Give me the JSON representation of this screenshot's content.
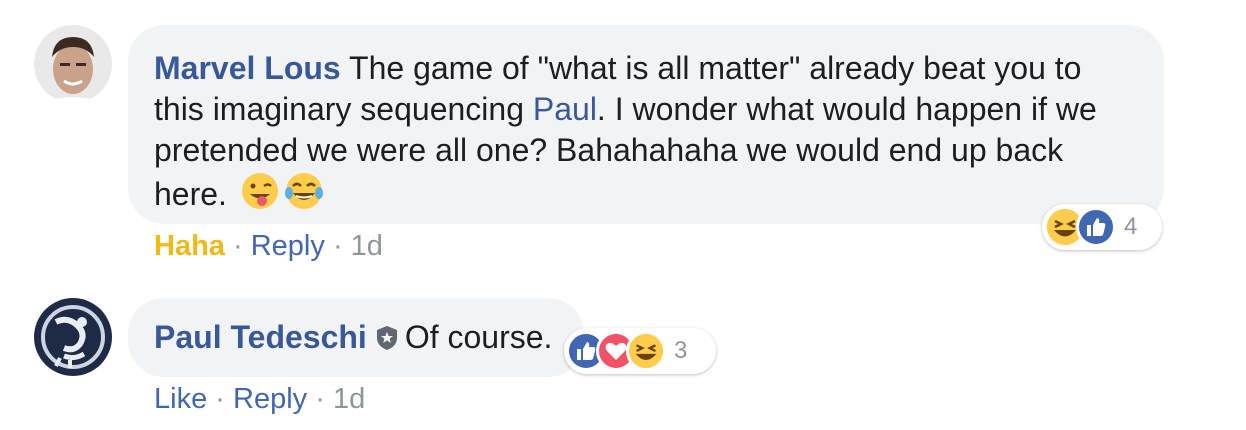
{
  "comment1": {
    "author": "Marvel Lous",
    "text_before": " The game of \"what is all matter\" already beat you to this imaginary sequencing ",
    "mention": "Paul",
    "text_after": ". I wonder what would happen if we pretended we were all one? Bahahahaha we would end up back here.",
    "action_reacted": "Haha",
    "action_reply": "Reply",
    "separator": "·",
    "time": "1d",
    "reaction_count": "4",
    "reaction_icons": [
      "haha-icon",
      "like-icon"
    ],
    "emojis": [
      "winking-tongue-emoji",
      "tears-of-joy-emoji"
    ]
  },
  "comment2": {
    "author": "Paul Tedeschi",
    "text": "Of course.",
    "action_like": "Like",
    "action_reply": "Reply",
    "separator": "·",
    "time": "1d",
    "reaction_count": "3",
    "reaction_icons": [
      "like-icon",
      "love-icon",
      "haha-icon"
    ]
  },
  "colors": {
    "name_link": "#385898",
    "bubble_bg": "#f2f3f5",
    "haha_yellow": "#f0ba15",
    "like_blue": "#4267b2",
    "love_red": "#f25268"
  }
}
